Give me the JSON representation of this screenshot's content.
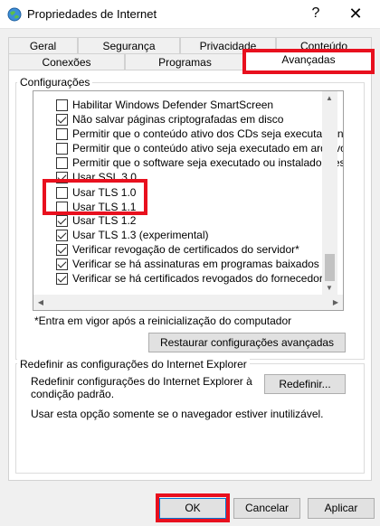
{
  "window": {
    "title": "Propriedades de Internet",
    "help_glyph": "?",
    "close_glyph": "✕"
  },
  "tabs": {
    "row_back": [
      "Geral",
      "Segurança",
      "Privacidade",
      "Conteúdo"
    ],
    "row_front": [
      "Conexões",
      "Programas",
      "Avançadas"
    ],
    "selected": "Avançadas"
  },
  "settings": {
    "group_label": "Configurações",
    "items": [
      {
        "label": "Habilitar Windows Defender SmartScreen",
        "checked": false
      },
      {
        "label": "Não salvar páginas criptografadas em disco",
        "checked": true
      },
      {
        "label": "Permitir que o conteúdo ativo dos CDs seja executado no",
        "checked": false
      },
      {
        "label": "Permitir que o conteúdo ativo seja executado em arquivos",
        "checked": false
      },
      {
        "label": "Permitir que o software seja executado ou instalado mesm",
        "checked": false
      },
      {
        "label": "Usar SSL 3.0",
        "checked": true
      },
      {
        "label": "Usar TLS 1.0",
        "checked": false
      },
      {
        "label": "Usar TLS 1.1",
        "checked": false
      },
      {
        "label": "Usar TLS 1.2",
        "checked": true
      },
      {
        "label": "Usar TLS 1.3 (experimental)",
        "checked": true
      },
      {
        "label": "Verificar revogação de certificados do servidor*",
        "checked": true
      },
      {
        "label": "Verificar se há assinaturas em programas baixados",
        "checked": true
      },
      {
        "label": "Verificar se há certificados revogados do fornecedor",
        "checked": true
      }
    ],
    "footnote": "*Entra em vigor após a reinicialização do computador",
    "restore_button": "Restaurar configurações avançadas"
  },
  "reset": {
    "group_label": "Redefinir as configurações do Internet Explorer",
    "description_line1": "Redefinir configurações do Internet Explorer à",
    "description_line2": "condição padrão.",
    "button": "Redefinir...",
    "note": "Usar esta opção somente se o navegador estiver inutilizável."
  },
  "footer": {
    "ok": "OK",
    "cancel": "Cancelar",
    "apply": "Aplicar"
  },
  "colors": {
    "highlight": "#e8101e"
  }
}
